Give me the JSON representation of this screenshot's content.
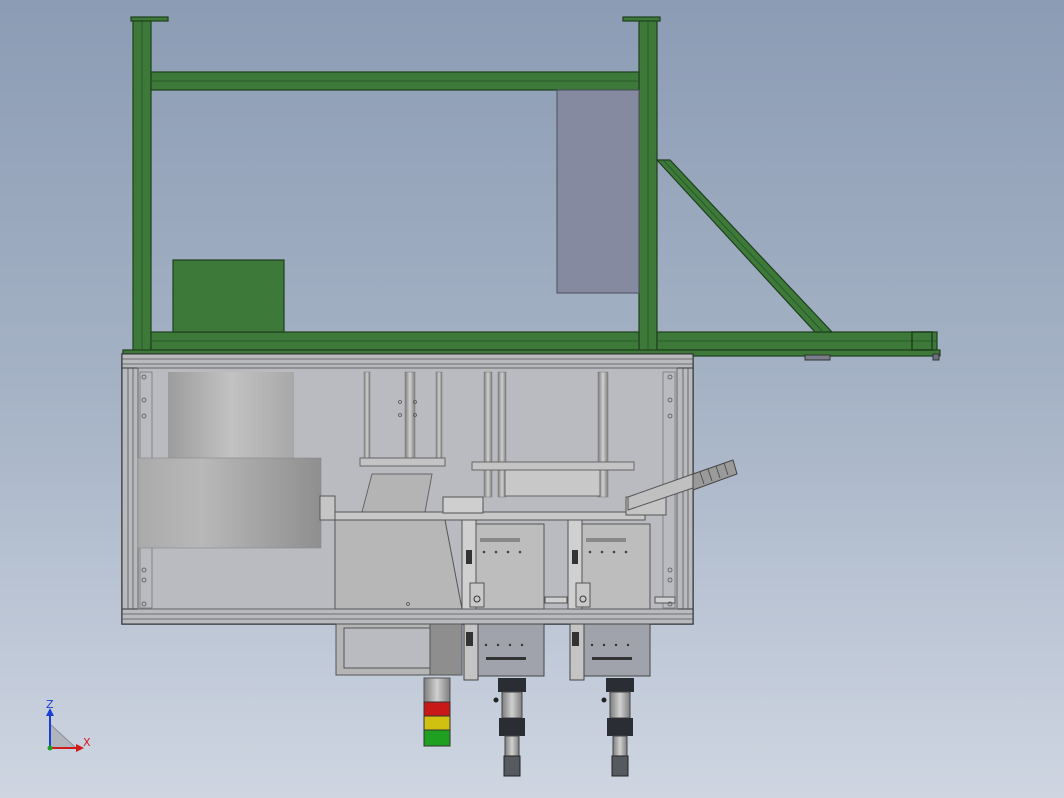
{
  "viewport": {
    "background_top": "#8c9cb4",
    "background_bottom": "#cfd6e2"
  },
  "colors": {
    "frame_green": "#3d7a3a",
    "frame_green_dark": "#1f3e1d",
    "cabinet_gray": "#a7a9ad",
    "panel_glass": "#b9bbc0",
    "steel_light": "#c4c4c4",
    "steel_dark": "#555a60",
    "slate_panel": "#868aa0",
    "light_red": "#c81818",
    "light_yellow": "#d0c010",
    "light_green": "#20a020"
  },
  "triad": {
    "z_label": "Z",
    "x_label": "X",
    "z_color": "#1a3fd6",
    "x_color": "#d21a1a"
  },
  "stack_light": {
    "levels": [
      "red",
      "yellow",
      "green"
    ]
  }
}
